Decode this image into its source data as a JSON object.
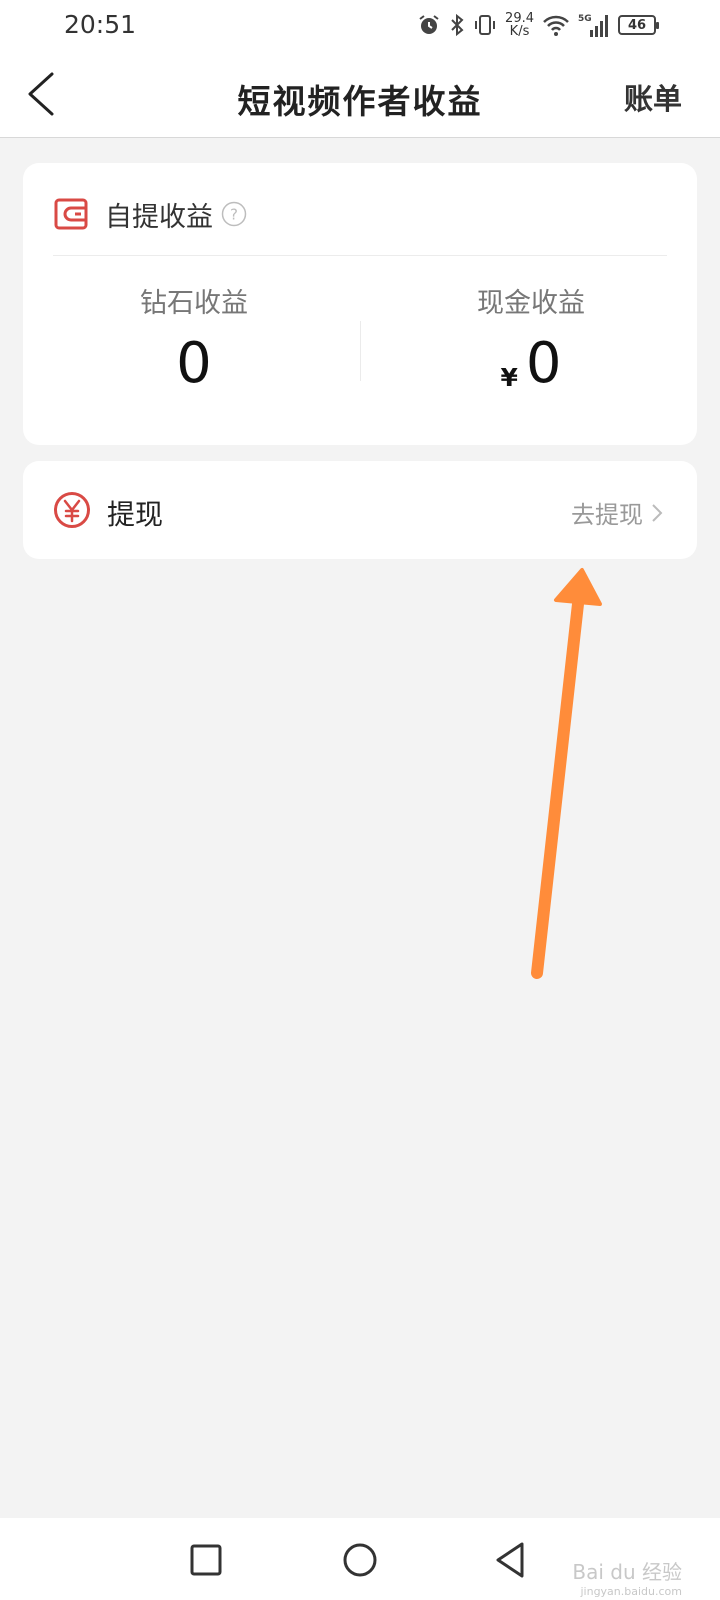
{
  "status_bar": {
    "time": "20:51",
    "network_speed_value": "29.4",
    "network_speed_unit": "K/s",
    "network_type": "5G",
    "battery": "46",
    "icons": [
      "alarm-icon",
      "bluetooth-icon",
      "vibrate-icon",
      "wifi-icon",
      "signal-icon",
      "battery-icon"
    ]
  },
  "nav": {
    "back_icon": "chevron-left-icon",
    "title": "短视频作者收益",
    "bill_label": "账单"
  },
  "earnings_card": {
    "icon": "wallet-icon",
    "title": "自提收益",
    "help_icon": "question-circle-icon",
    "diamond": {
      "label": "钻石收益",
      "value": "0"
    },
    "cash": {
      "label": "现金收益",
      "currency": "¥",
      "value": "0"
    }
  },
  "withdraw_card": {
    "icon": "yuan-circle-icon",
    "label": "提现",
    "action_label": "去提现",
    "action_icon": "chevron-right-icon"
  },
  "annotation": {
    "type": "arrow",
    "color": "#ff8c3a"
  },
  "system_nav": {
    "icons": [
      "recent-apps-icon",
      "home-icon",
      "back-icon"
    ]
  },
  "watermark": {
    "text": "Bai du 经验",
    "subtext": "jingyan.baidu.com"
  },
  "colors": {
    "accent_red": "#d94a45",
    "background": "#f3f3f3",
    "card": "#ffffff",
    "arrow": "#ff8c3a"
  }
}
